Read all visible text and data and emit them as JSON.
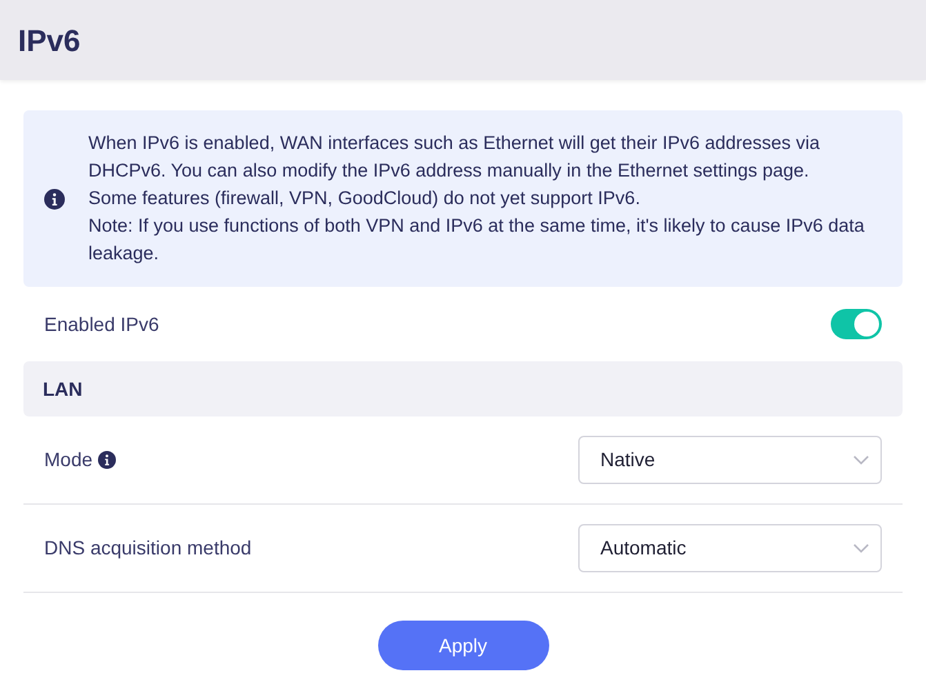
{
  "page_title": "IPv6",
  "notice": {
    "paragraphs": [
      "When IPv6 is enabled, WAN interfaces such as Ethernet will get their IPv6 addresses via DHCPv6. You can also modify the IPv6 address manually in the Ethernet settings page.",
      "Some features (firewall, VPN, GoodCloud) do not yet support IPv6.",
      "Note: If you use functions of both VPN and IPv6 at the same time, it's likely to cause IPv6 data leakage."
    ]
  },
  "enable": {
    "label": "Enabled IPv6",
    "on": true
  },
  "section": {
    "title": "LAN"
  },
  "rows": [
    {
      "label": "Mode",
      "info": true,
      "value": "Native"
    },
    {
      "label": "DNS acquisition method",
      "info": false,
      "value": "Automatic"
    }
  ],
  "apply_button": "Apply"
}
